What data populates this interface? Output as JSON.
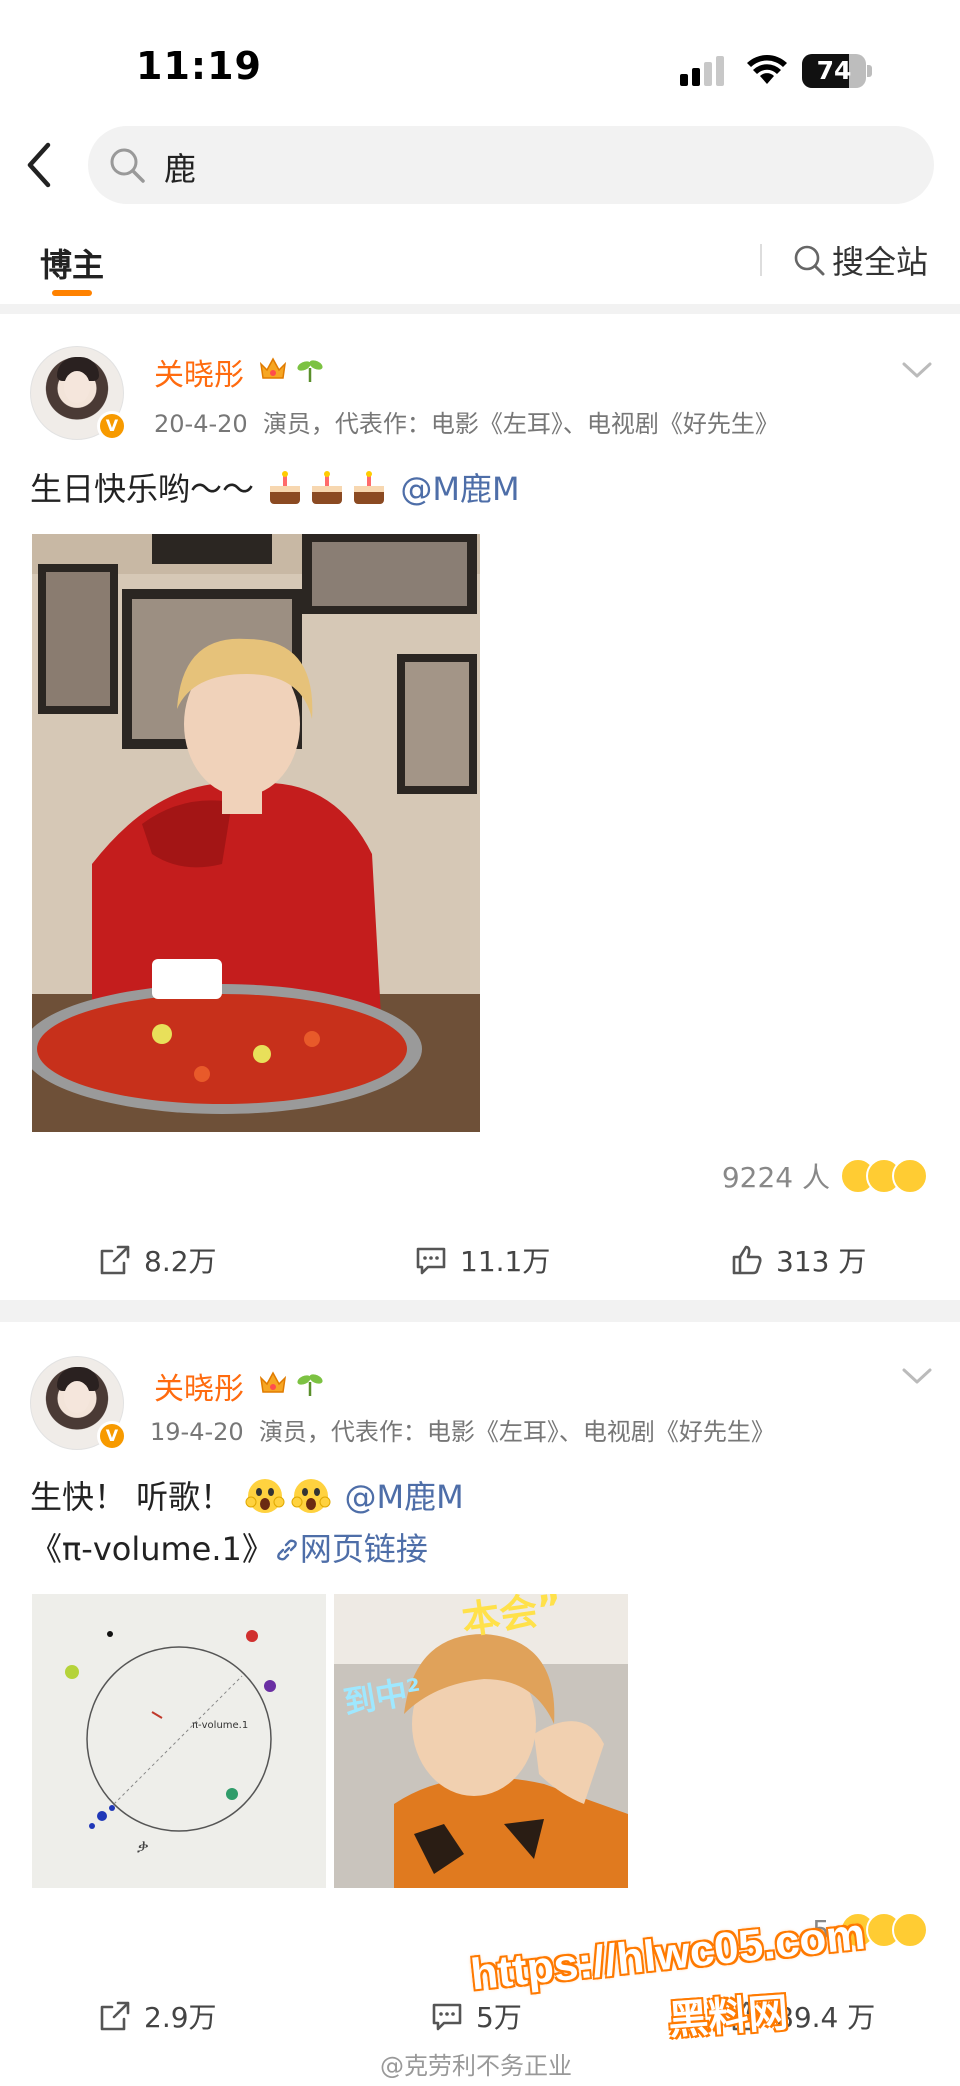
{
  "status_bar": {
    "time": "11:19",
    "battery": "74",
    "battery_fraction": 0.74
  },
  "search": {
    "query": "鹿"
  },
  "tabs": {
    "active": "博主",
    "search_all": "搜全站"
  },
  "posts": [
    {
      "username": "关晓彤",
      "date": "20-4-20",
      "bio": "演员，代表作：电影《左耳》、电视剧《好先生》",
      "text": "生日快乐哟～～",
      "mention": "@M鹿M",
      "reaction_count": "9224 人",
      "reposts": "8.2万",
      "comments": "11.1万",
      "likes": "313 万"
    },
    {
      "username": "关晓彤",
      "date": "19-4-20",
      "bio": "演员，代表作：电影《左耳》、电视剧《好先生》",
      "text": "生快！ 听歌！",
      "mention": "@M鹿M",
      "line2_title": "《π-volume.1》",
      "line2_link": "网页链接",
      "image_caption": "π-volume.1",
      "reaction_count": "5",
      "reposts": "2.9万",
      "comments": "5万",
      "likes": "89.4 万"
    }
  ],
  "watermark": {
    "url": "https://hlwc05.com",
    "brand": "黑料网",
    "credit": "@克劳利不务正业"
  },
  "colors": {
    "accent": "#ff8200",
    "username": "#ff6b0f",
    "mention": "#4e6ea8"
  }
}
